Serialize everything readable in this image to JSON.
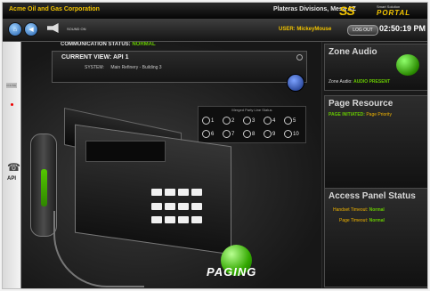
{
  "header": {
    "company": "Acme Oil and Gas Corporation",
    "division": "Plateras Divisions, Mesa AZ",
    "logo_main": "SS",
    "logo_top": "Smart Solution",
    "logo_portal": "PORTAL"
  },
  "toolbar": {
    "sound_label": "SOUND ON",
    "user_label": "USER:",
    "user_name": "MickeyMouse",
    "logout_label": "LOG OUT",
    "clock": "02:50:19 PM"
  },
  "sidebar": {
    "api_label": "API",
    "tiny_status": "ONLINE"
  },
  "communication": {
    "label": "COMMUNICATION STATUS:",
    "value": "NORMAL"
  },
  "current_view": {
    "label": "CURRENT VIEW:",
    "value": "API 1",
    "system_label": "SYSTEM:",
    "system_value": "Main Refinery - Building 3"
  },
  "merged": {
    "title": "Merged Party Line Status",
    "items": [
      "1",
      "2",
      "3",
      "4",
      "5",
      "6",
      "7",
      "8",
      "9",
      "10"
    ]
  },
  "zone_audio": {
    "title": "Zone Audio",
    "label": "Zone Audio:",
    "value": "AUDIO PRESENT"
  },
  "page_resource": {
    "title": "Page Resource",
    "label": "PAGE INITIATED:",
    "value": "Page Priority"
  },
  "access_panel": {
    "title": "Access Panel Status",
    "handset_label": "Handset Timeout:",
    "handset_value": "Normal",
    "page_label": "Page Timeout:",
    "page_value": "Normal"
  },
  "paging": {
    "label": "PAGING"
  }
}
